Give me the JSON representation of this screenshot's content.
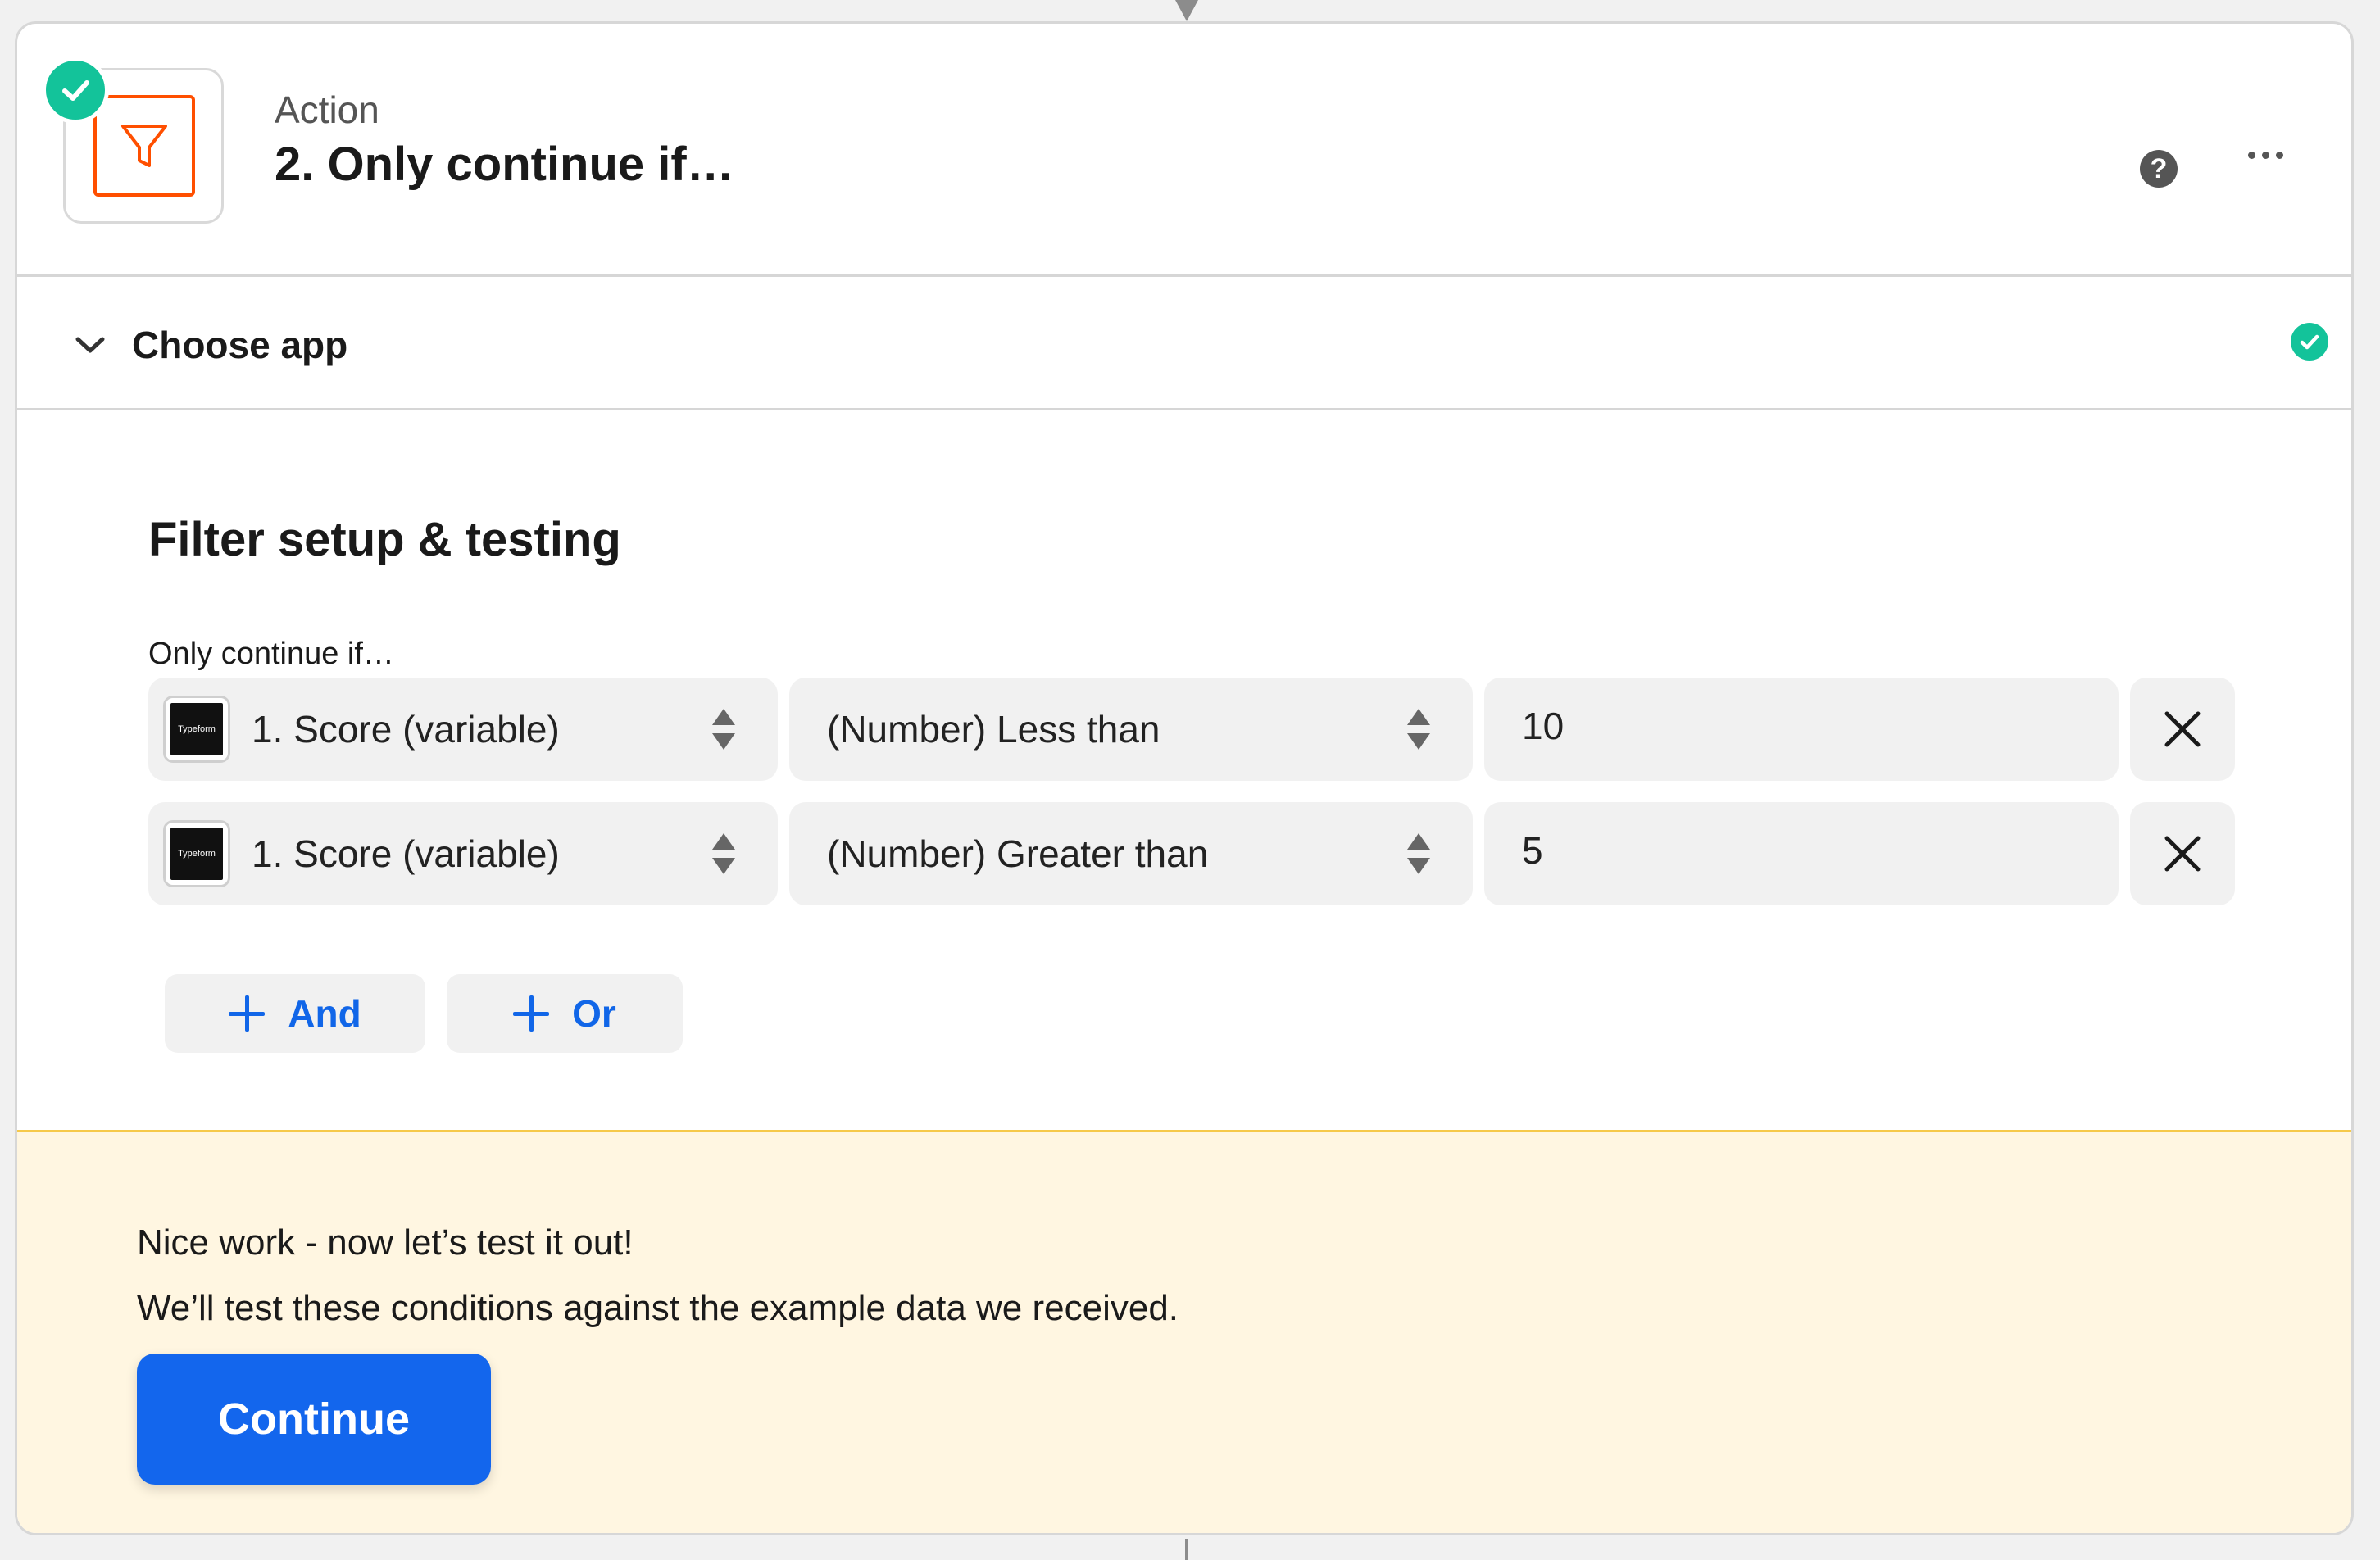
{
  "colors": {
    "accent_blue": "#1366ed",
    "success_green": "#13c39a",
    "filter_orange": "#ff4f00",
    "test_panel_bg": "#fff6e1"
  },
  "header": {
    "icon": "filter-funnel-icon",
    "kind": "Action",
    "title": "2. Only continue if…"
  },
  "choose_app": {
    "label": "Choose app"
  },
  "filter": {
    "section_title": "Filter setup & testing",
    "label": "Only continue if…",
    "conditions": [
      {
        "app_icon_text": "Typeform",
        "field": "1. Score (variable)",
        "operator": "(Number) Less than",
        "value": "10"
      },
      {
        "app_icon_text": "Typeform",
        "field": "1. Score (variable)",
        "operator": "(Number) Greater than",
        "value": "5"
      }
    ],
    "add_and_label": "And",
    "add_or_label": "Or"
  },
  "test": {
    "line1": "Nice work - now let’s test it out!",
    "line2": "We’ll test these conditions against the example data we received.",
    "continue_label": "Continue"
  }
}
